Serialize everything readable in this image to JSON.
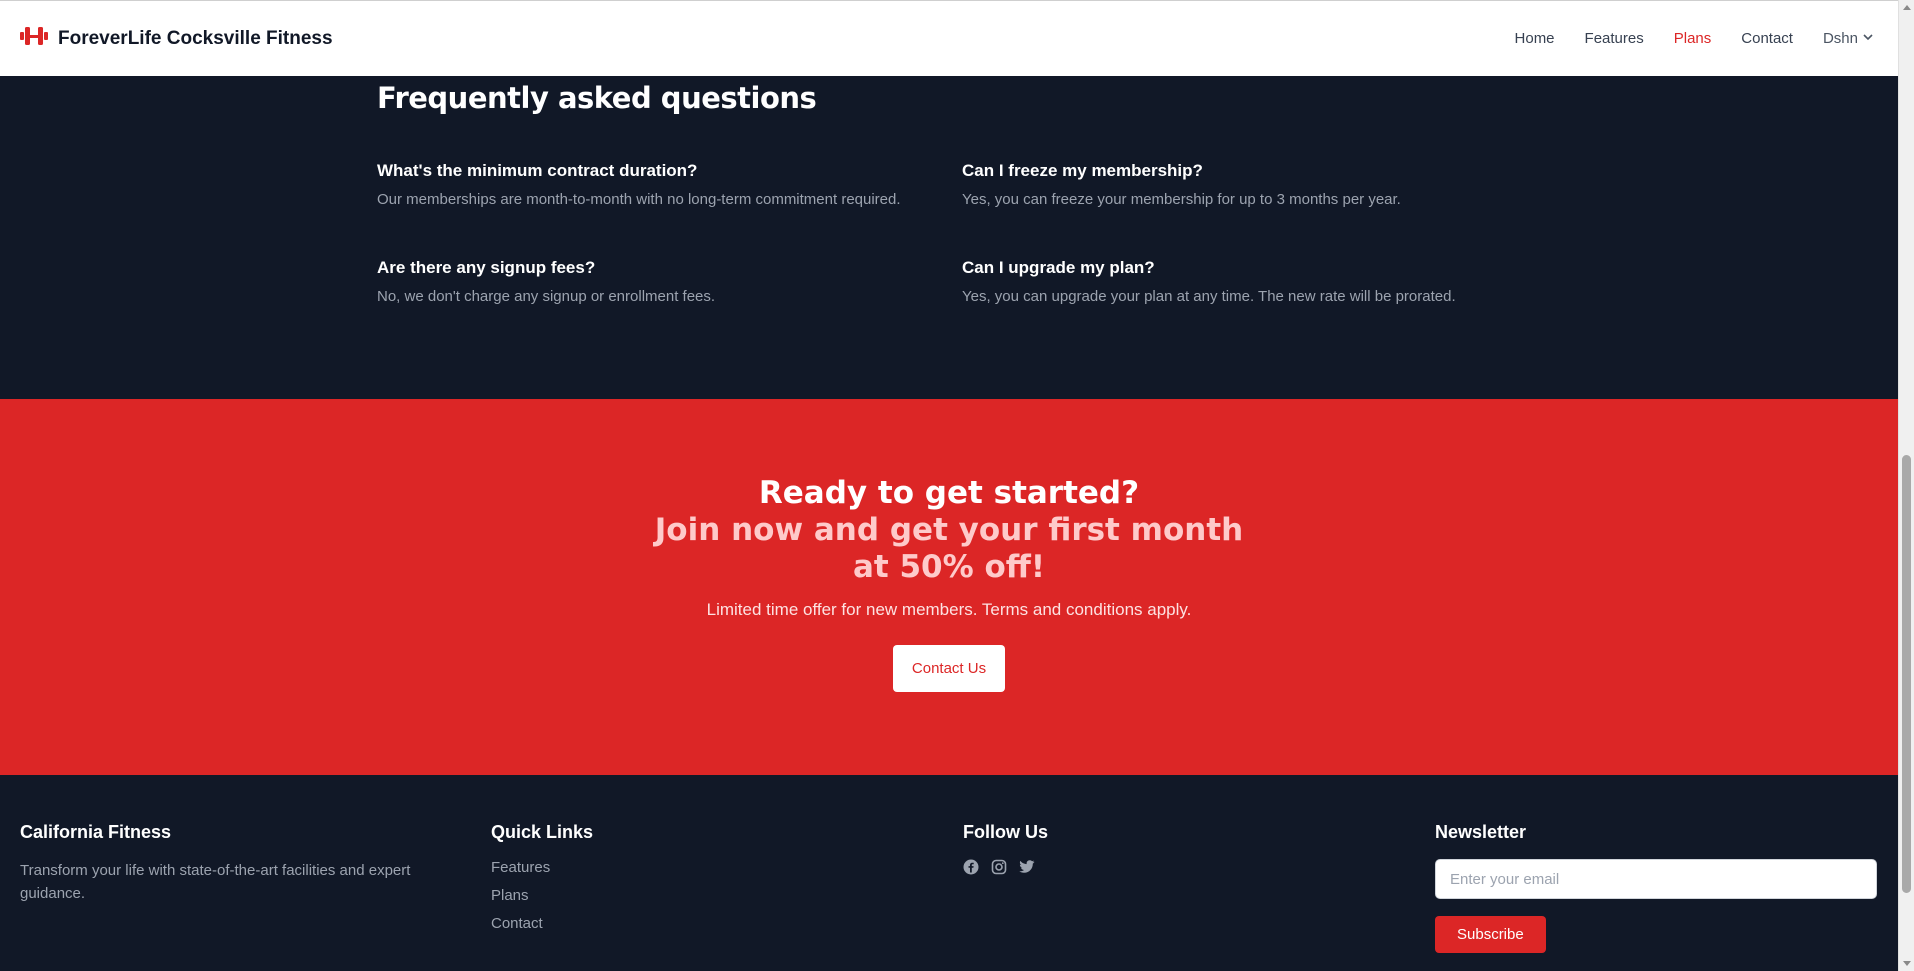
{
  "nav": {
    "brand": "ForeverLife Cocksville Fitness",
    "links": [
      {
        "label": "Home",
        "active": false
      },
      {
        "label": "Features",
        "active": false
      },
      {
        "label": "Plans",
        "active": true
      },
      {
        "label": "Contact",
        "active": false
      }
    ],
    "user": "Dshn"
  },
  "faq": {
    "title": "Frequently asked questions",
    "items": [
      {
        "question": "What's the minimum contract duration?",
        "answer": "Our memberships are month-to-month with no long-term commitment required."
      },
      {
        "question": "Can I freeze my membership?",
        "answer": "Yes, you can freeze your membership for up to 3 months per year."
      },
      {
        "question": "Are there any signup fees?",
        "answer": "No, we don't charge any signup or enrollment fees."
      },
      {
        "question": "Can I upgrade my plan?",
        "answer": "Yes, you can upgrade your plan at any time. The new rate will be prorated."
      }
    ]
  },
  "cta": {
    "heading": "Ready to get started?",
    "subheading": "Join now and get your first month at 50% off!",
    "text": "Limited time offer for new members. Terms and conditions apply.",
    "button": "Contact Us"
  },
  "footer": {
    "about": {
      "title": "California Fitness",
      "text": "Transform your life with state-of-the-art facilities and expert guidance."
    },
    "quick_links": {
      "title": "Quick Links",
      "links": [
        "Features",
        "Plans",
        "Contact"
      ]
    },
    "follow": {
      "title": "Follow Us",
      "icons": [
        "facebook-icon",
        "instagram-icon",
        "twitter-icon"
      ]
    },
    "newsletter": {
      "title": "Newsletter",
      "placeholder": "Enter your email",
      "button": "Subscribe"
    }
  },
  "colors": {
    "brand": "#dc2626",
    "dark": "#111827",
    "muted": "#9ca3af"
  }
}
